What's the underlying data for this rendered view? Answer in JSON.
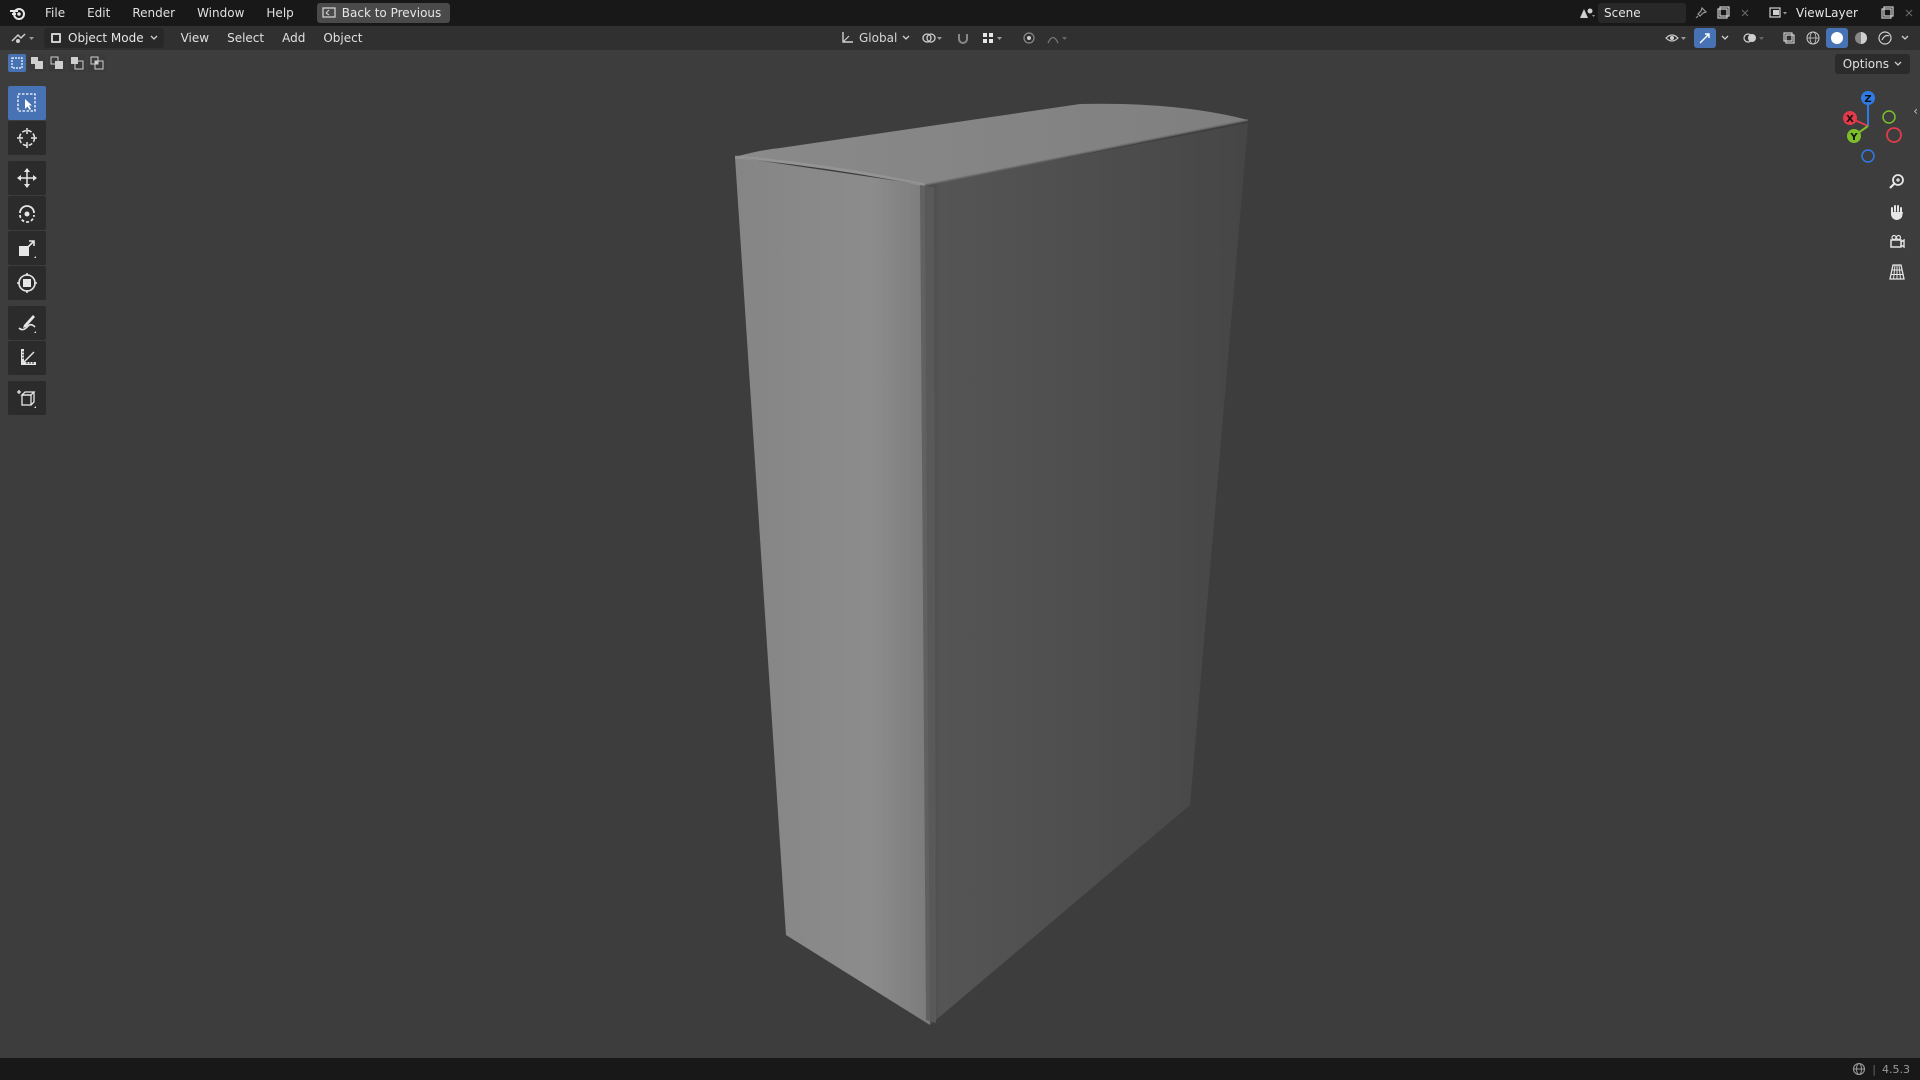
{
  "topbar": {
    "menu": [
      "File",
      "Edit",
      "Render",
      "Window",
      "Help"
    ],
    "back_button": "Back to Previous",
    "scene_name": "Scene",
    "view_layer": "ViewLayer"
  },
  "header": {
    "mode": "Object Mode",
    "menus": [
      "View",
      "Select",
      "Add",
      "Object"
    ],
    "transform_orientation": "Global"
  },
  "viewport": {
    "options_label": "Options",
    "gizmo": {
      "z": "Z",
      "x": "X",
      "y": "Y"
    }
  },
  "toolbar": {
    "tools": [
      "select-box-icon",
      "cursor-icon",
      "move-icon",
      "rotate-icon",
      "scale-icon",
      "transform-icon",
      "annotate-icon",
      "measure-icon",
      "add-cube-icon"
    ]
  },
  "status": {
    "version": "4.5.3"
  },
  "colors": {
    "accent": "#4772b3",
    "background": "#3d3d3d",
    "topbar": "#181818",
    "header": "#303030"
  }
}
